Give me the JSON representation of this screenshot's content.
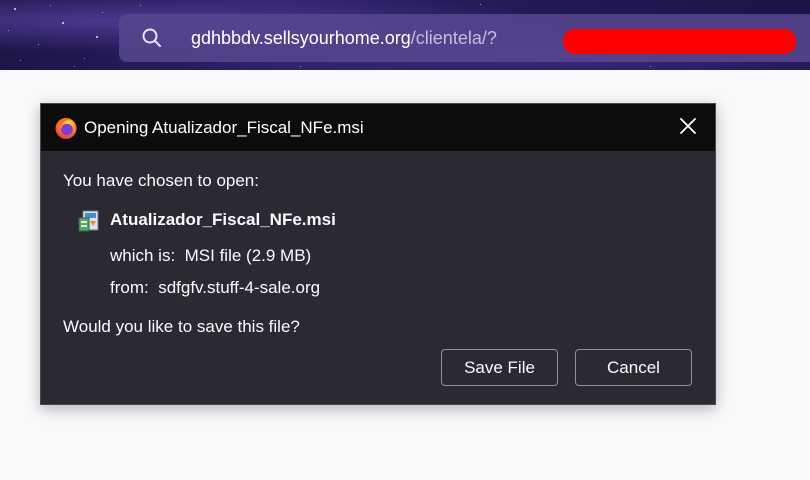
{
  "browser": {
    "url": {
      "domain": "gdhbbdv.sellsyourhome.org",
      "path": "/clientela/?"
    }
  },
  "dialog": {
    "title": "Opening Atualizador_Fiscal_NFe.msi",
    "prompt": "You have chosen to open:",
    "file_name": "Atualizador_Fiscal_NFe.msi",
    "type_label": "which is:",
    "type_value": "MSI file (2.9 MB)",
    "from_label": "from:",
    "from_value": "sdfgfv.stuff-4-sale.org",
    "question": "Would you like to save this file?",
    "save_label": "Save File",
    "cancel_label": "Cancel",
    "close_icon": "close-icon",
    "app_icon": "firefox-icon",
    "file_icon": "msi-installer-icon"
  },
  "colors": {
    "dialog_bg": "#2b2a33",
    "titlebar_bg": "#0c0c0d",
    "redaction": "#ff0000",
    "page_bg": "#f9f9fb"
  }
}
